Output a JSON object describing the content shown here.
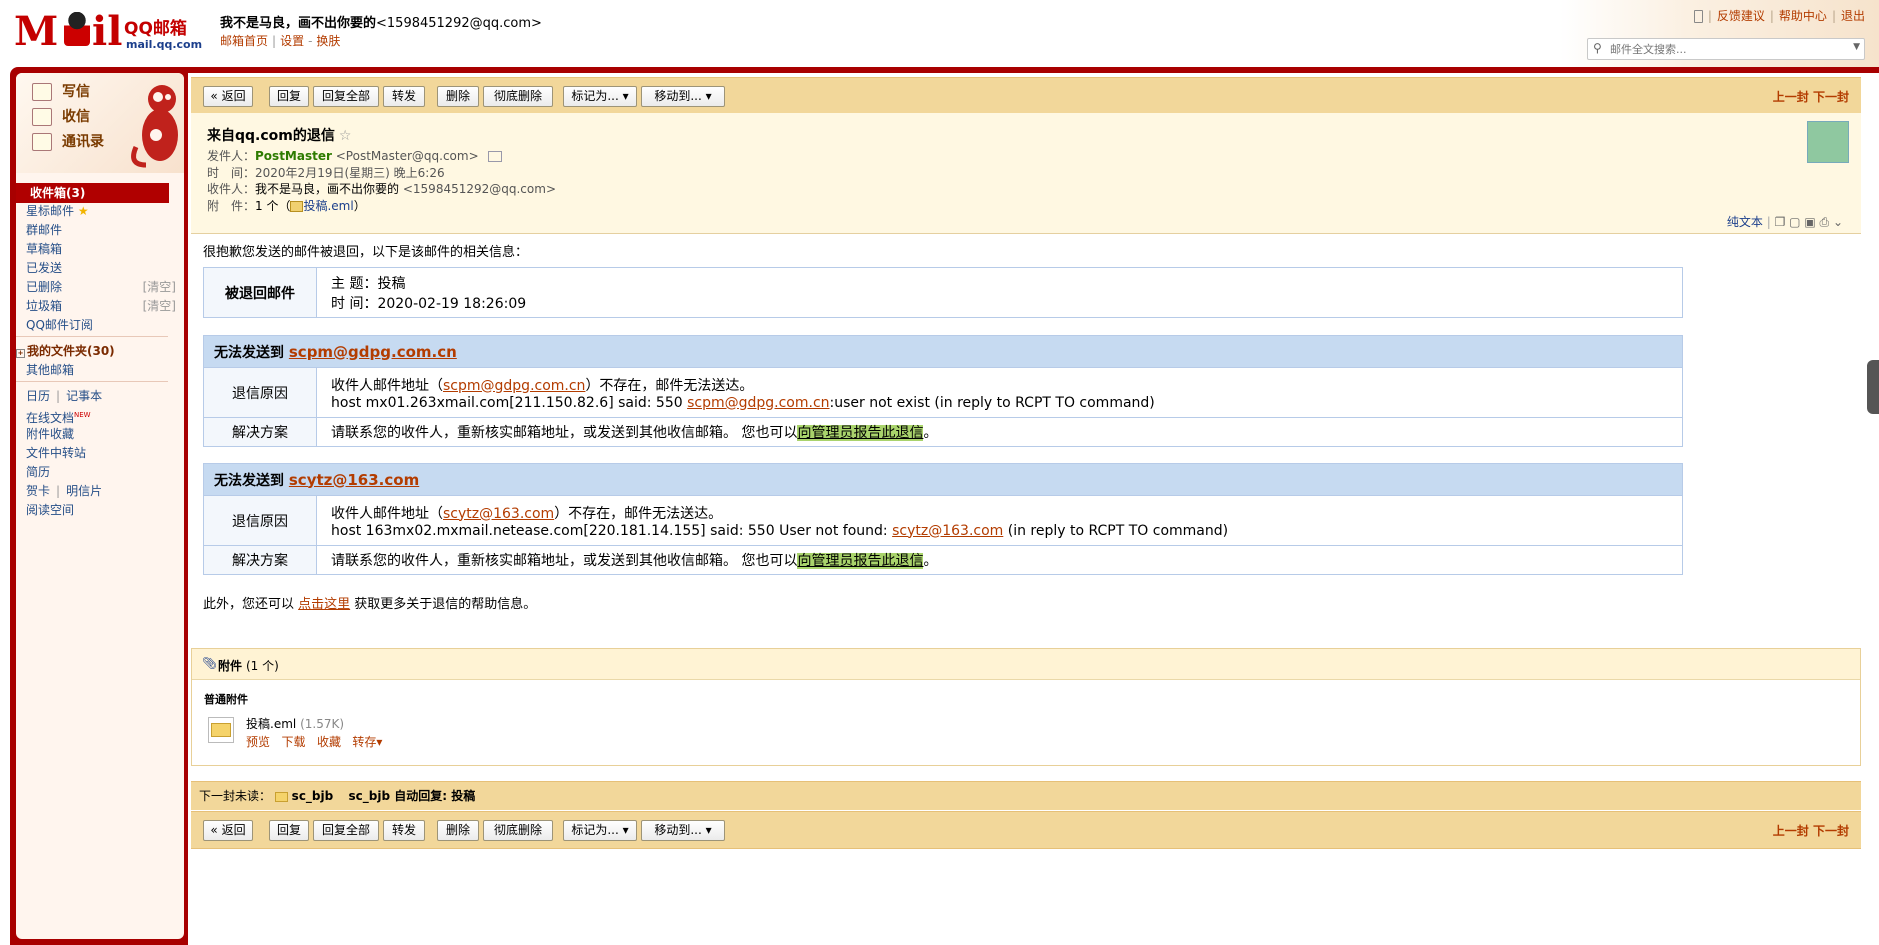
{
  "header": {
    "logo_m": "M",
    "logo_il": "il",
    "logo_brand": "QQ邮箱",
    "logo_domain": "mail.qq.com",
    "user_name": "我不是马良，画不出你要的",
    "user_email": "<1598451292@qq.com>",
    "links": [
      "邮箱首页",
      "设置",
      "换肤"
    ],
    "top_links": [
      "反馈建议",
      "帮助中心",
      "退出"
    ],
    "search_placeholder": "邮件全文搜索..."
  },
  "sidebar": {
    "actions": [
      "写信",
      "收信",
      "通讯录"
    ],
    "inbox": "收件箱(3)",
    "folders": [
      {
        "label": "星标邮件"
      },
      {
        "label": "群邮件"
      },
      {
        "label": "草稿箱"
      },
      {
        "label": "已发送"
      },
      {
        "label": "已删除",
        "clear": "[清空]"
      },
      {
        "label": "垃圾箱",
        "clear": "[清空]"
      },
      {
        "label": "QQ邮件订阅"
      }
    ],
    "my_folders": "我的文件夹(30)",
    "other_mail": "其他邮箱",
    "tools": [
      "日历",
      "记事本",
      "在线文档",
      "附件收藏",
      "文件中转站",
      "简历",
      "贺卡",
      "明信片",
      "阅读空间"
    ],
    "new_badge": "NEW"
  },
  "toolbar": {
    "back": "« 返回",
    "reply": "回复",
    "reply_all": "回复全部",
    "forward": "转发",
    "delete": "删除",
    "delete_perm": "彻底删除",
    "mark_as": "标记为... ▾",
    "move_to": "移动到... ▾",
    "prev": "上一封",
    "next": "下一封"
  },
  "mail": {
    "subject": "来自qq.com的退信",
    "star": "☆",
    "from_key": "发件人：",
    "from_name": "PostMaster",
    "from_addr": "<PostMaster@qq.com>",
    "time_key": "时　间：",
    "time_val": "2020年2月19日(星期三) 晚上6:26",
    "to_key": "收件人：",
    "to_name": "我不是马良，画不出你要的",
    "to_addr": "<1598451292@qq.com>",
    "att_key": "附　件：",
    "att_val": "1 个（",
    "att_name": "投稿.eml",
    "att_close": "）",
    "plain_text": "纯文本"
  },
  "body": {
    "intro": "很抱歉您发送的邮件被退回，以下是该邮件的相关信息：",
    "returned_label": "被退回邮件",
    "subject_line": "主 题：投稿",
    "time_line": "时 间：2020-02-19 18:26:09",
    "fail1": {
      "head": "无法发送到 ",
      "addr": "scpm@gdpg.com.cn",
      "reason_label": "退信原因",
      "reason1_pre": "收件人邮件地址（",
      "reason1_addr": "scpm@gdpg.com.cn",
      "reason1_post": "）不存在，邮件无法送达。",
      "reason2_pre": "host mx01.263xmail.com[211.150.82.6] said: 550 ",
      "reason2_addr": "scpm@gdpg.com.cn",
      "reason2_post": ":user not exist (in reply to RCPT TO command)",
      "solution_label": "解决方案",
      "solution": "请联系您的收件人，重新核实邮箱地址，或发送到其他收信邮箱。 您也可以",
      "solution_link": "向管理员报告此退信",
      "solution_end": "。"
    },
    "fail2": {
      "head": "无法发送到 ",
      "addr": "scytz@163.com",
      "reason_label": "退信原因",
      "reason1_pre": "收件人邮件地址（",
      "reason1_addr": "scytz@163.com",
      "reason1_post": "）不存在，邮件无法送达。",
      "reason2_pre": "host 163mx02.mxmail.netease.com[220.181.14.155] said: 550 User not found: ",
      "reason2_addr": "scytz@163.com",
      "reason2_post": " (in reply to RCPT TO command)",
      "solution_label": "解决方案",
      "solution": "请联系您的收件人，重新核实邮箱地址，或发送到其他收信邮箱。 您也可以",
      "solution_link": "向管理员报告此退信",
      "solution_end": "。"
    },
    "footer_pre": "此外，您还可以 ",
    "footer_link": "点击这里",
    "footer_post": " 获取更多关于退信的帮助信息。"
  },
  "attachments": {
    "title": "附件",
    "count": "(1 个)",
    "section": "普通附件",
    "file_name": "投稿.eml",
    "file_size": "(1.57K)",
    "actions": [
      "预览",
      "下载",
      "收藏",
      "转存▾"
    ]
  },
  "next_unread": {
    "label": "下一封未读：",
    "sender": "sc_bjb",
    "subject": "sc_bjb 自动回复: 投稿"
  }
}
